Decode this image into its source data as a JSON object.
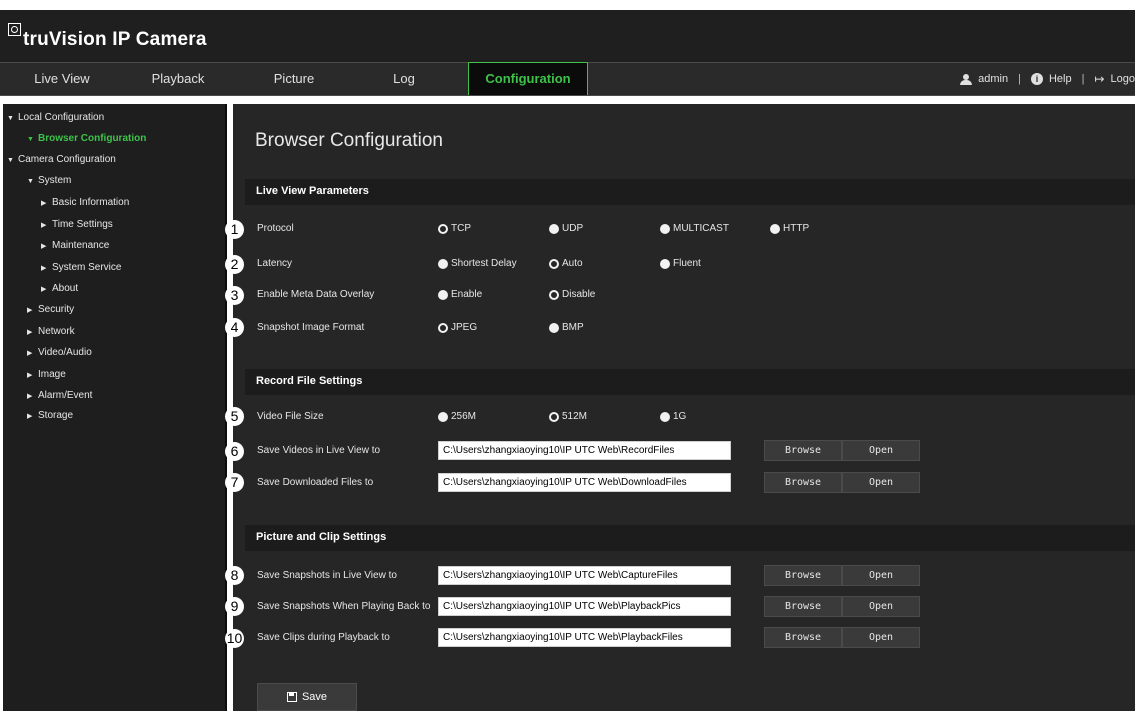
{
  "app": {
    "brand": "truVision IP Camera"
  },
  "nav": {
    "tabs": [
      "Live View",
      "Playback",
      "Picture",
      "Log",
      "Configuration"
    ],
    "active": "Configuration",
    "user": "admin",
    "help": "Help",
    "logout": "Logo"
  },
  "sidebar": {
    "local_configuration": "Local Configuration",
    "browser_configuration": "Browser Configuration",
    "camera_configuration": "Camera Configuration",
    "system": "System",
    "basic_information": "Basic Information",
    "time_settings": "Time Settings",
    "maintenance": "Maintenance",
    "system_service": "System Service",
    "about": "About",
    "security": "Security",
    "network": "Network",
    "video_audio": "Video/Audio",
    "image": "Image",
    "alarm_event": "Alarm/Event",
    "storage": "Storage"
  },
  "page": {
    "title": "Browser Configuration"
  },
  "sections": {
    "live_view": "Live View Parameters",
    "record_file": "Record File Settings",
    "picture_clip": "Picture and Clip Settings"
  },
  "rows": {
    "protocol": {
      "num": "1",
      "label": "Protocol",
      "options": [
        "TCP",
        "UDP",
        "MULTICAST",
        "HTTP"
      ],
      "selected": "TCP"
    },
    "latency": {
      "num": "2",
      "label": "Latency",
      "options": [
        "Shortest Delay",
        "Auto",
        "Fluent"
      ],
      "selected": "Auto"
    },
    "meta": {
      "num": "3",
      "label": "Enable Meta Data Overlay",
      "options": [
        "Enable",
        "Disable"
      ],
      "selected": "Disable"
    },
    "snapshot_format": {
      "num": "4",
      "label": "Snapshot Image Format",
      "options": [
        "JPEG",
        "BMP"
      ],
      "selected": "JPEG"
    },
    "video_size": {
      "num": "5",
      "label": "Video File Size",
      "options": [
        "256M",
        "512M",
        "1G"
      ],
      "selected": "512M"
    },
    "save_videos": {
      "num": "6",
      "label": "Save Videos in Live View to",
      "path": "C:\\Users\\zhangxiaoying10\\IP UTC Web\\RecordFiles"
    },
    "save_downloads": {
      "num": "7",
      "label": "Save Downloaded Files to",
      "path": "C:\\Users\\zhangxiaoying10\\IP UTC Web\\DownloadFiles"
    },
    "save_snapshots": {
      "num": "8",
      "label": "Save Snapshots in Live View to",
      "path": "C:\\Users\\zhangxiaoying10\\IP UTC Web\\CaptureFiles"
    },
    "save_snapshots_playback": {
      "num": "9",
      "label": "Save Snapshots When Playing Back to",
      "path": "C:\\Users\\zhangxiaoying10\\IP UTC Web\\PlaybackPics"
    },
    "save_clips": {
      "num": "10",
      "label": "Save Clips during Playback to",
      "path": "C:\\Users\\zhangxiaoying10\\IP UTC Web\\PlaybackFiles"
    }
  },
  "buttons": {
    "browse": "Browse",
    "open": "Open",
    "save": "Save"
  },
  "colors": {
    "accent": "#3ec24a",
    "background": "#262626",
    "header": "#1f1f1f"
  }
}
